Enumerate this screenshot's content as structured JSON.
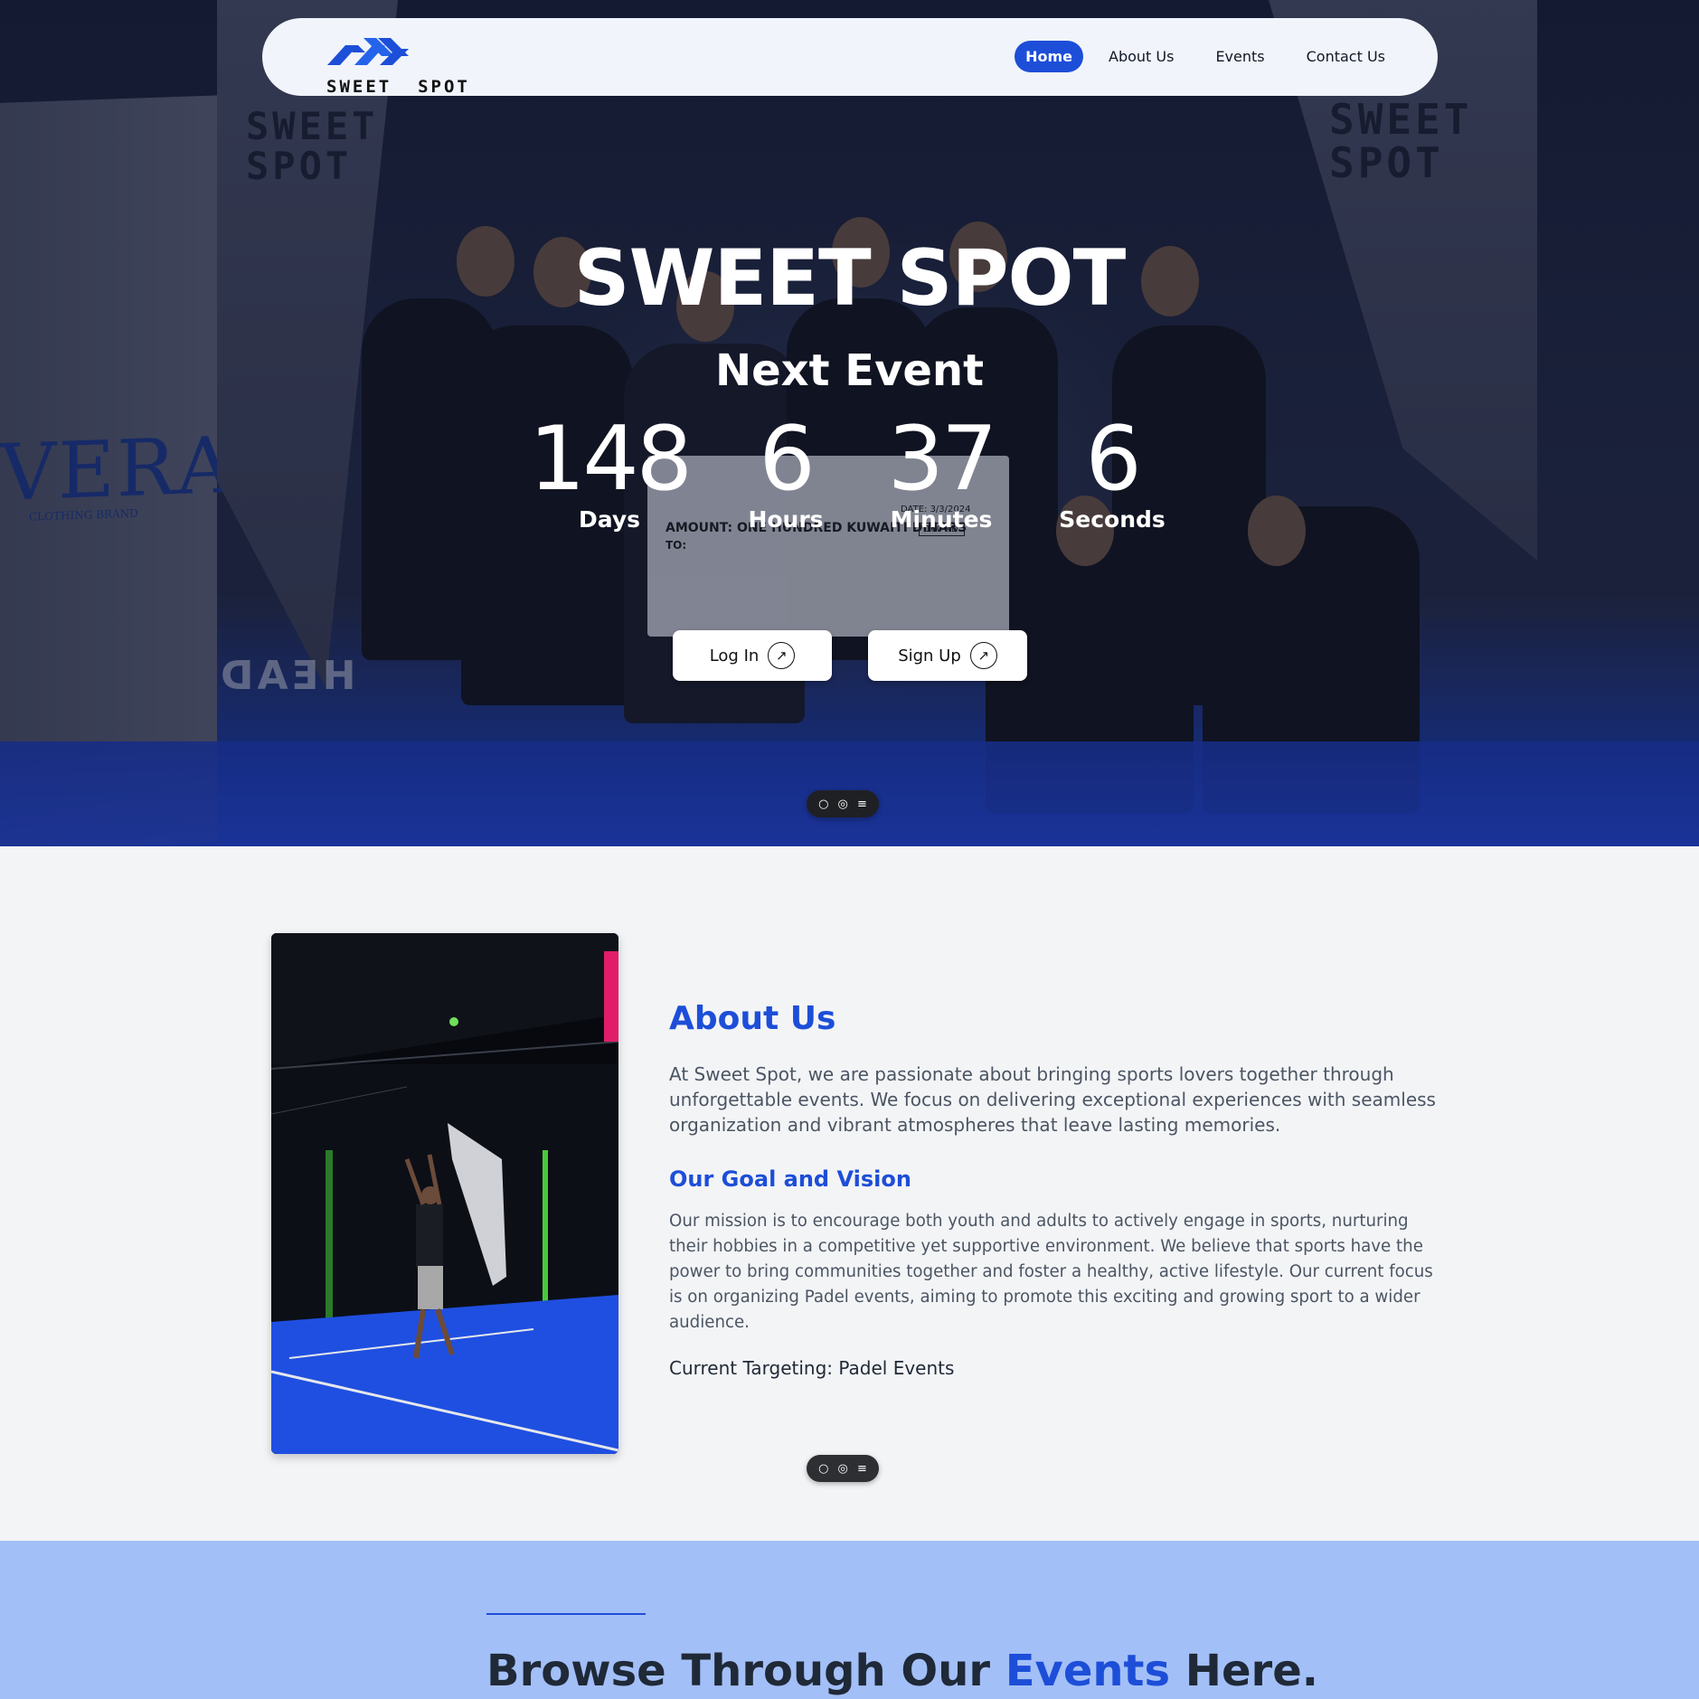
{
  "nav": {
    "logo_text": "SWEET  SPOT",
    "links": [
      "Home",
      "About Us",
      "Events",
      "Contact Us"
    ],
    "active": "Home"
  },
  "hero": {
    "title": "SWEET SPOT",
    "subtitle": "Next Event",
    "countdown": [
      {
        "value": "148",
        "label": "Days"
      },
      {
        "value": "6",
        "label": "Hours"
      },
      {
        "value": "37",
        "label": "Minutes"
      },
      {
        "value": "6",
        "label": "Seconds"
      }
    ],
    "login_label": "Log In",
    "signup_label": "Sign Up",
    "photo_text": {
      "banner_left": "SWEET\nSPOT",
      "banner_right": "SWEET\nSPOT",
      "vera": "VERA",
      "vera_sub": "CLOTHING BRAND",
      "check_amount": "AMOUNT:   ONE HUNDRED KUWAITI DINARS",
      "check_to": "TO:",
      "check_date": "DATE: 3/3/2024",
      "check_kd": "100 KD",
      "head_left": "HEAD"
    }
  },
  "about": {
    "title": "About Us",
    "paragraph": "At Sweet Spot, we are passionate about bringing sports lovers together through unforgettable events. We focus on delivering exceptional experiences with seamless organization and vibrant atmospheres that leave lasting memories.",
    "goal_title": "Our Goal and Vision",
    "goal_paragraph": "Our mission is to encourage both youth and adults to actively engage in sports, nurturing their hobbies in a competitive yet supportive environment. We believe that sports have the power to bring communities together and foster a healthy, active lifestyle. Our current focus is on organizing Padel events, aiming to promote this exciting and growing sport to a wider audience.",
    "targeting": "Current Targeting: Padel Events"
  },
  "events": {
    "title_pre": "Browse Through Our ",
    "title_accent": "Events",
    "title_post": " Here."
  },
  "colors": {
    "accent": "#1d4ed8",
    "events_bg": "#a3bff7",
    "page_bg": "#f3f4f6"
  },
  "icons": [
    "logo-chevrons-icon",
    "arrow-up-right-icon",
    "comment-icon",
    "eye-icon",
    "menu-icon"
  ]
}
